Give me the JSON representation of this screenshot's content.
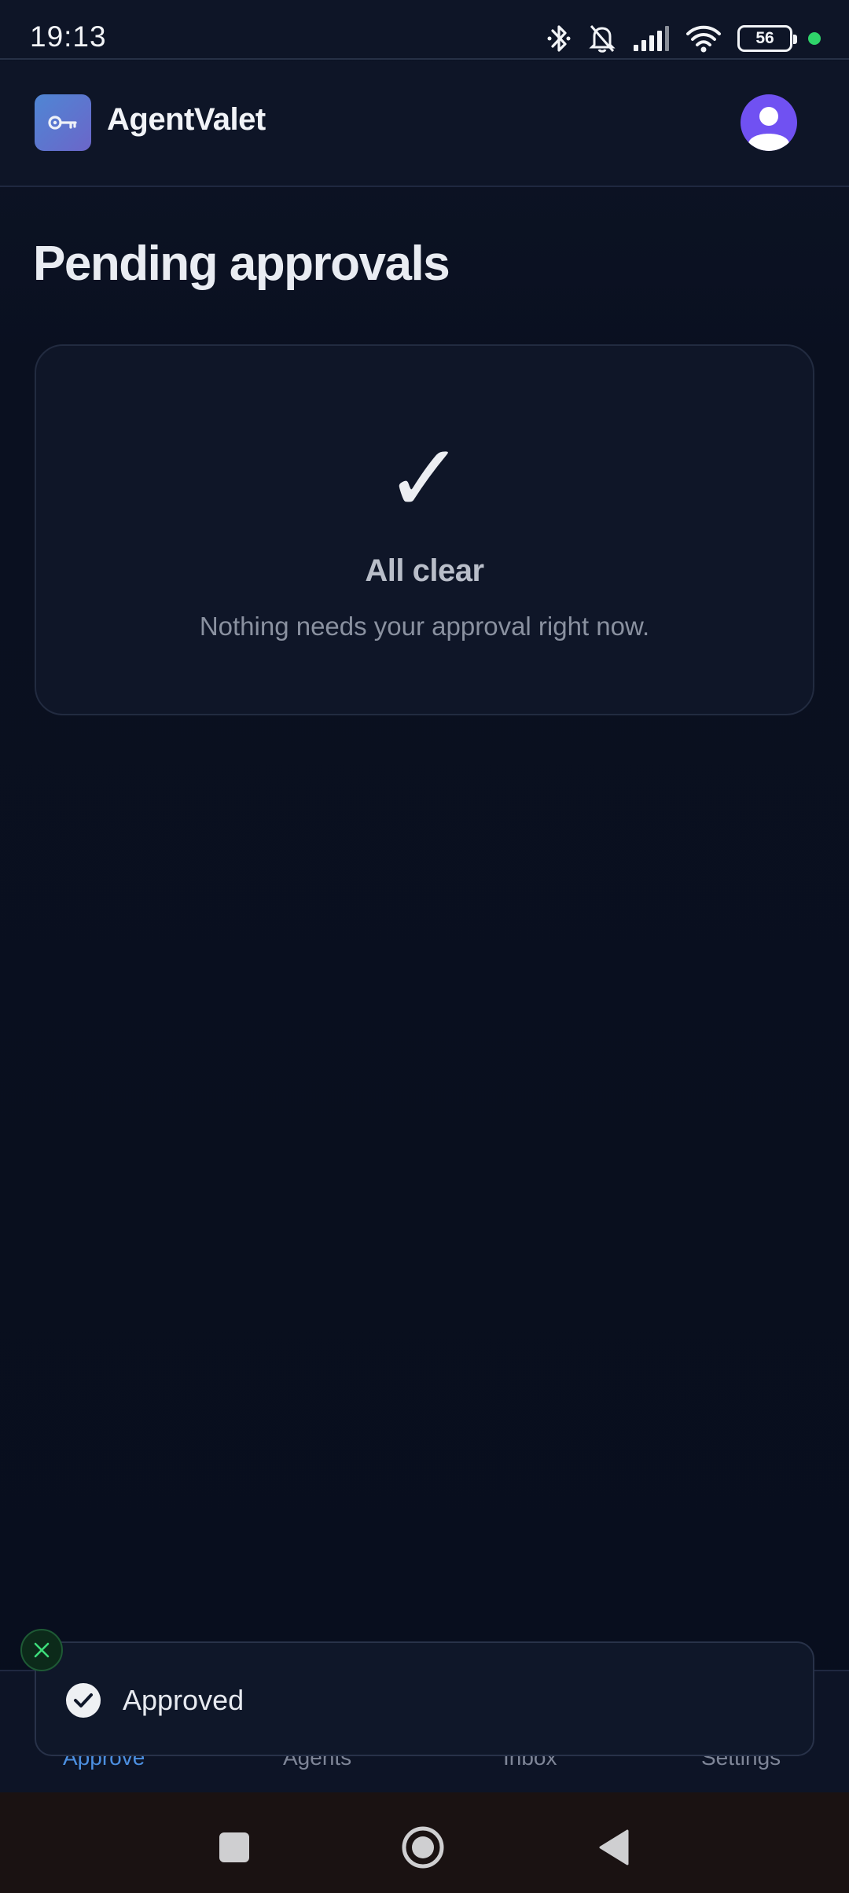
{
  "status_bar": {
    "time": "19:13",
    "battery": "56",
    "icons": [
      "bluetooth-icon",
      "bell-off-icon",
      "signal-icon",
      "wifi-icon",
      "battery-icon"
    ],
    "indicator_color": "#2fd46a"
  },
  "header": {
    "app_name": "AgentValet",
    "logo_icon": "key-icon",
    "avatar_icon": "user-avatar-icon"
  },
  "page": {
    "title": "Pending approvals"
  },
  "empty_state": {
    "icon": "check-mark-icon",
    "check": "✓",
    "title": "All clear",
    "subtitle": "Nothing needs your approval right now."
  },
  "bottom_nav": {
    "items": [
      {
        "label": "Approve",
        "active": true
      },
      {
        "label": "Agents",
        "active": false
      },
      {
        "label": "Inbox",
        "active": false
      },
      {
        "label": "Settings",
        "active": false
      }
    ],
    "active_color": "#4c8fe0"
  },
  "toast": {
    "message": "Approved",
    "icon": "check-circle-icon",
    "close_icon": "close-icon"
  },
  "system_nav": {
    "buttons": [
      "recents-icon",
      "home-icon",
      "back-icon"
    ]
  }
}
